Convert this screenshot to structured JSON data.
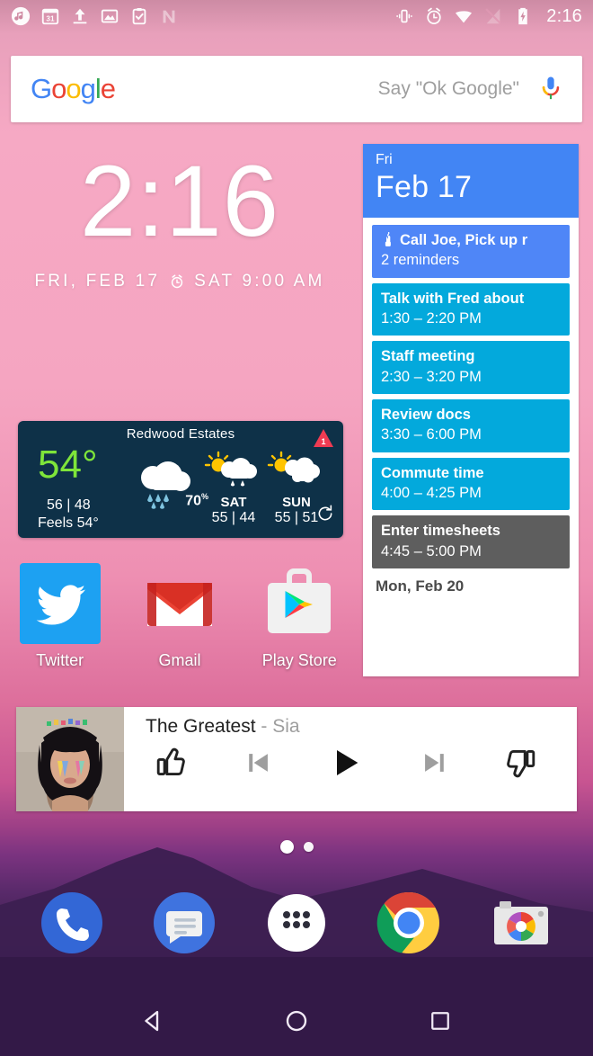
{
  "status_bar": {
    "time": "2:16",
    "left_icons": [
      "music-note-icon",
      "calendar-31-icon",
      "upload-icon",
      "photo-icon",
      "clipboard-check-icon",
      "nova-launcher-icon"
    ],
    "right_icons": [
      "vibrate-icon",
      "alarm-icon",
      "wifi-icon",
      "no-sim-icon",
      "battery-charging-icon"
    ]
  },
  "search": {
    "logo_letters": [
      "G",
      "o",
      "o",
      "g",
      "l",
      "e"
    ],
    "hint": "Say \"Ok Google\"",
    "mic_icon": "microphone-icon"
  },
  "clock_widget": {
    "time": "2:16",
    "date": "FRI, FEB 17",
    "alarm_icon": "alarm-clock-icon",
    "alarm": "SAT 9:00 AM"
  },
  "weather": {
    "city": "Redwood Estates",
    "temperature": "54°",
    "high_low": "56 | 48",
    "feels_like": "Feels 54°",
    "precip_chance": "70",
    "precip_unit": "%",
    "alert_count": "1",
    "alert_icon": "weather-alert-triangle-icon",
    "refresh_icon": "refresh-icon",
    "accent_temp_color": "#7ee53a",
    "background_color": "#0e3148",
    "forecast": [
      {
        "day": "SAT",
        "high_low": "55 | 44",
        "icon": "sun-rain-cloud-icon"
      },
      {
        "day": "SUN",
        "high_low": "55 | 51",
        "icon": "sun-cloud-icon"
      }
    ]
  },
  "calendar": {
    "header_color": "#4285F4",
    "day_of_week": "Fri",
    "date": "Feb 17",
    "next_day": "Mon, Feb 20",
    "events": [
      {
        "title": "Call Joe, Pick up r",
        "subtitle": "2 reminders",
        "type": "reminder",
        "icon": "reminder-finger-string-icon"
      },
      {
        "title": "Talk with Fred about",
        "subtitle": "1:30 – 2:20 PM",
        "type": "event"
      },
      {
        "title": "Staff meeting",
        "subtitle": "2:30 – 3:20 PM",
        "type": "event"
      },
      {
        "title": "Review docs",
        "subtitle": "3:30 – 6:00 PM",
        "type": "event"
      },
      {
        "title": "Commute time",
        "subtitle": "4:00 – 4:25 PM",
        "type": "event"
      },
      {
        "title": "Enter timesheets",
        "subtitle": "4:45 – 5:00 PM",
        "type": "grey"
      }
    ]
  },
  "apps": [
    {
      "label": "Twitter",
      "icon": "twitter-icon"
    },
    {
      "label": "Gmail",
      "icon": "gmail-icon"
    },
    {
      "label": "Play Store",
      "icon": "play-store-icon"
    }
  ],
  "music": {
    "title": "The Greatest",
    "separator": " - ",
    "artist": "Sia",
    "album_art": "sia-the-greatest-album-art",
    "controls": [
      {
        "name": "thumbs-up-icon"
      },
      {
        "name": "previous-track-icon"
      },
      {
        "name": "play-icon"
      },
      {
        "name": "next-track-icon"
      },
      {
        "name": "thumbs-down-icon"
      }
    ]
  },
  "page_indicator": {
    "total": 2,
    "active": 1
  },
  "dock": [
    {
      "name": "phone-icon"
    },
    {
      "name": "messages-icon"
    },
    {
      "name": "app-drawer-icon"
    },
    {
      "name": "chrome-icon"
    },
    {
      "name": "camera-icon"
    }
  ],
  "nav_bar": [
    {
      "name": "back-button"
    },
    {
      "name": "home-button"
    },
    {
      "name": "recents-button"
    }
  ]
}
